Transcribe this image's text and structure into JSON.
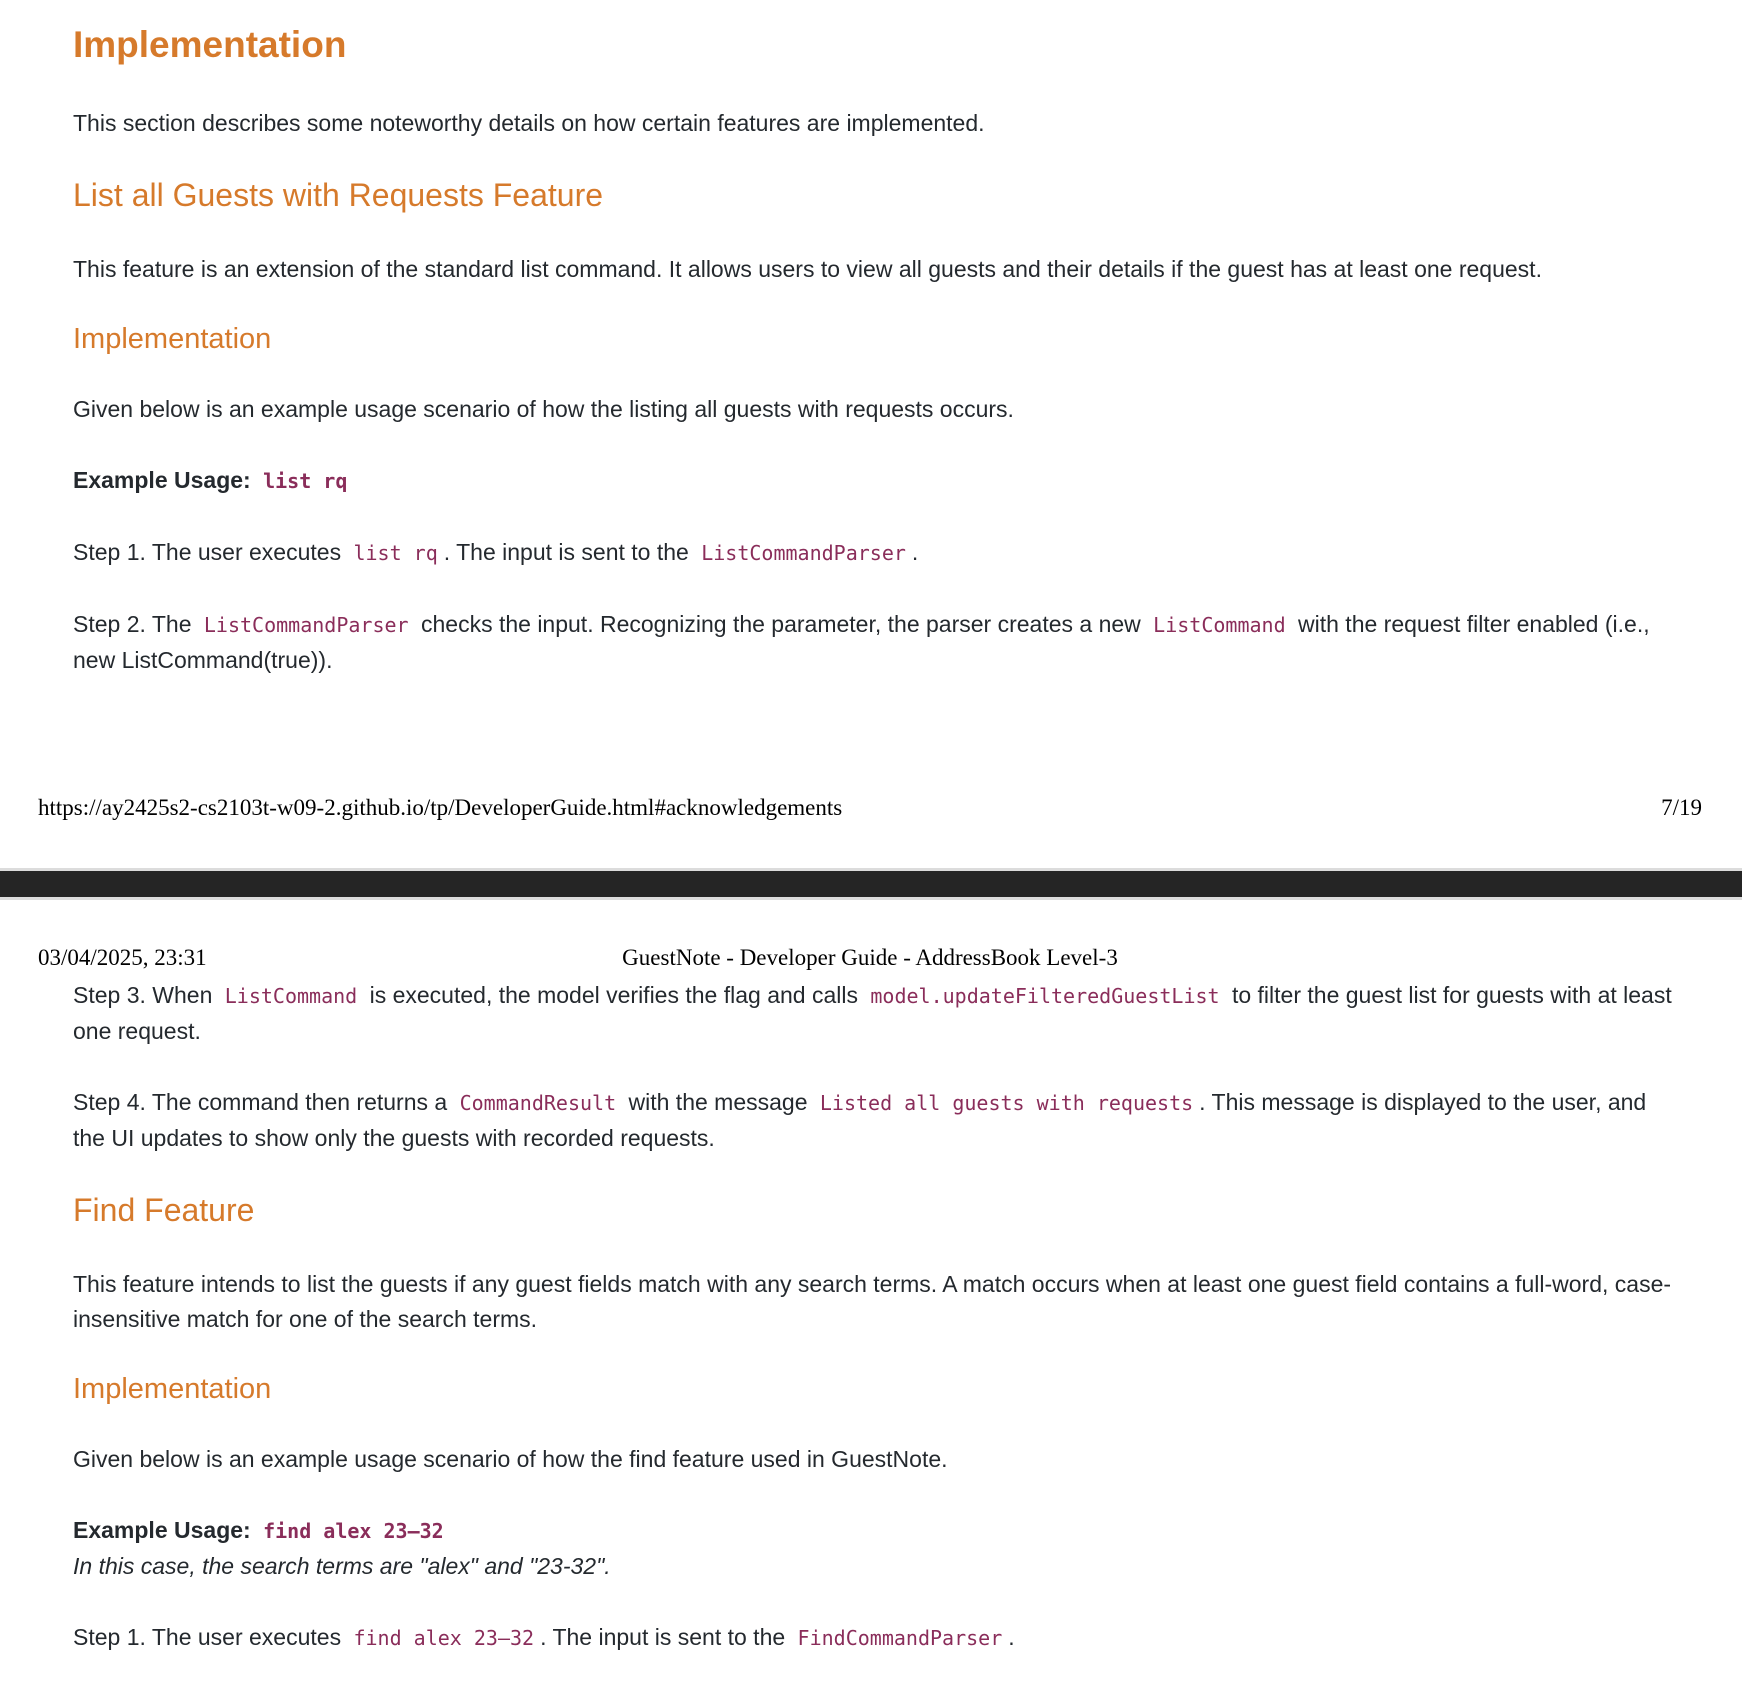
{
  "page1": {
    "h_implementation": "Implementation",
    "intro": "This section describes some noteworthy details on how certain features are implemented.",
    "h_list_feature": "List all Guests with Requests Feature",
    "list_desc": "This feature is an extension of the standard list command. It allows users to view all guests and their details if the guest has at least one request.",
    "h_impl_sub": "Implementation",
    "given_below": "Given below is an example usage scenario of how the listing all guests with requests occurs.",
    "example_label": "Example Usage:",
    "example_code": "list rq",
    "step1": {
      "a": "Step 1. The user executes",
      "code1": "list rq",
      "b": ". The input is sent to the",
      "code2": "ListCommandParser",
      "c": "."
    },
    "step2": {
      "a": "Step 2. The",
      "code1": "ListCommandParser",
      "b": "checks the input. Recognizing the parameter, the parser creates a new",
      "code2": "ListCommand",
      "c": "with the request filter enabled (i.e., new ListCommand(true))."
    },
    "footer_url": "https://ay2425s2-cs2103t-w09-2.github.io/tp/DeveloperGuide.html#acknowledgements",
    "footer_page": "7/19"
  },
  "page2": {
    "header_date": "03/04/2025, 23:31",
    "header_title": "GuestNote - Developer Guide - AddressBook Level-3",
    "step3": {
      "a": "Step 3. When",
      "code1": "ListCommand",
      "b": "is executed, the model verifies the flag and calls",
      "code2": "model.updateFilteredGuestList",
      "c": "to filter the guest list for guests with at least one request."
    },
    "step4": {
      "a": "Step 4. The command then returns a",
      "code1": "CommandResult",
      "b": "with the message",
      "code2": "Listed all guests with requests",
      "c": ". This message is displayed to the user, and the UI updates to show only the guests with recorded requests."
    },
    "h_find_feature": "Find Feature",
    "find_desc": "This feature intends to list the guests if any guest fields match with any search terms. A match occurs when at least one guest field contains a full-word, case-insensitive match for one of the search terms.",
    "h_impl_sub": "Implementation",
    "given_below": "Given below is an example usage scenario of how the find feature used in GuestNote.",
    "example_label": "Example Usage:",
    "example_code": "find alex 23–32",
    "example_note": "In this case, the search terms are \"alex\" and \"23-32\".",
    "step1": {
      "a": "Step 1. The user executes",
      "code1": "find alex 23–32",
      "b": ". The input is sent to the",
      "code2": "FindCommandParser",
      "c": "."
    }
  }
}
